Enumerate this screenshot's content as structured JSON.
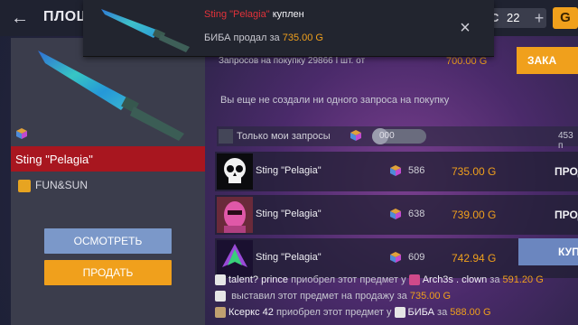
{
  "header": {
    "title": "ПЛОЩА",
    "currency_icon": "С",
    "currency_value": "22",
    "plus": "+",
    "gold_label": "G"
  },
  "notification": {
    "item_name": "Sting \"Pelagia\"",
    "item_status": "куплен",
    "seller": "БИБА",
    "sold_text": "продал за",
    "price": "735.00 G",
    "close_icon": "×"
  },
  "item": {
    "name": "Sting \"Pelagia\"",
    "collection": "FUN&SUN",
    "view_label": "ОСМОТРЕТЬ",
    "sell_label": "ПРОДАТЬ"
  },
  "requests": {
    "count_text": "Запросов на покупку 29866 I шт. от",
    "price": "700.00 G",
    "order_label": "ЗАКА",
    "empty_message": "Вы еще не создали ни одного запроса на покупку"
  },
  "filter": {
    "label": "Только мои запросы",
    "toggle_text": "000",
    "count": "453 п"
  },
  "listings": [
    {
      "name": "Sting \"Pelagia\"",
      "qty": "586",
      "price": "735.00 G",
      "action": "ПРОД",
      "thumb": "skull"
    },
    {
      "name": "Sting \"Pelagia\"",
      "qty": "638",
      "price": "739.00 G",
      "action": "ПРОД",
      "thumb": "pink-mask"
    },
    {
      "name": "Sting \"Pelagia\"",
      "qty": "609",
      "price": "742.94 G",
      "action": "КУП",
      "thumb": "purple-emblem"
    }
  ],
  "feed": [
    {
      "user": "talent? prince",
      "text": "приобрел этот предмет у",
      "other": "Arch3s . clown",
      "za": "за",
      "price": "591.20 G"
    },
    {
      "user": "",
      "text": "выставил этот предмет на продажу за",
      "other": "",
      "za": "",
      "price": "735.00 G"
    },
    {
      "user": "Ксеркс 42",
      "text": "приобрел этот предмет у",
      "other": "БИБА",
      "za": "за",
      "price": "588.00 G"
    }
  ],
  "colors": {
    "accent_gold": "#f0a01c",
    "accent_red": "#a8161f",
    "accent_blue": "#7b98c9"
  }
}
